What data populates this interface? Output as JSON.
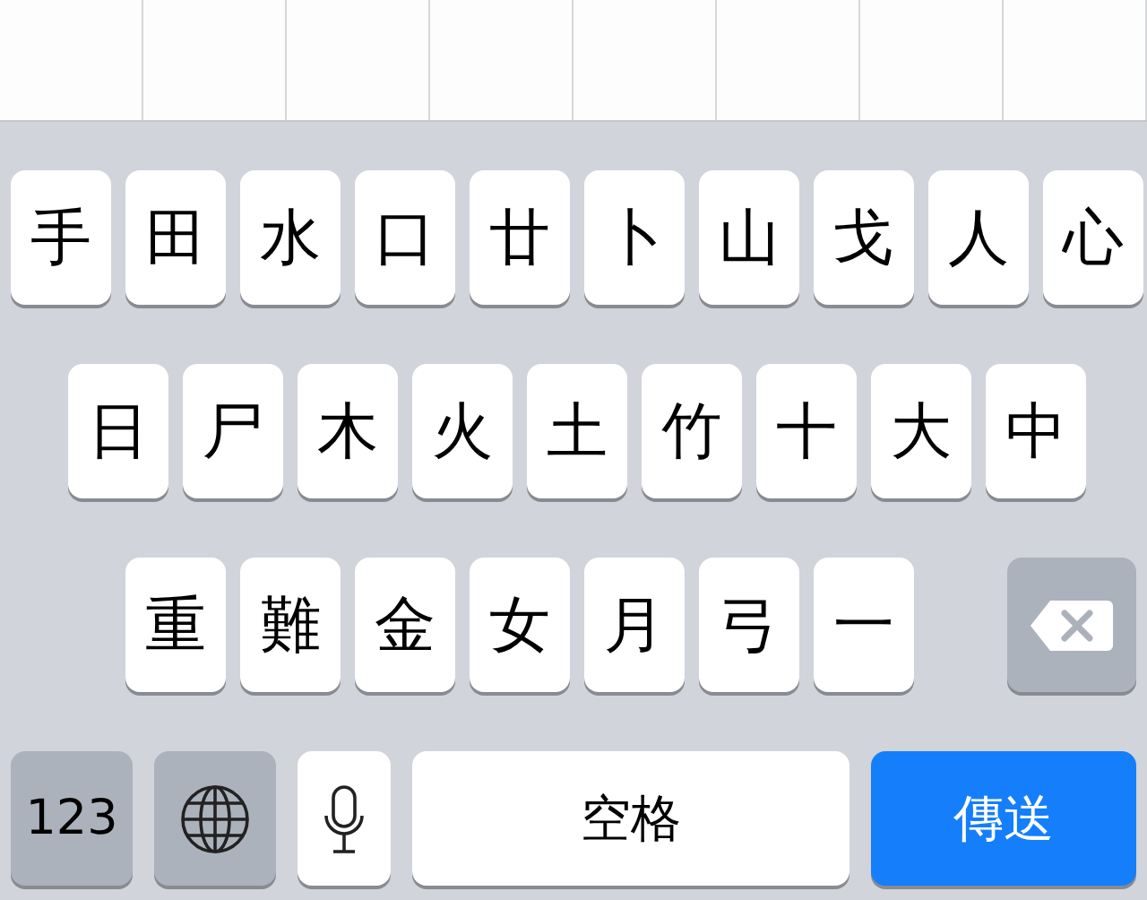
{
  "rows": [
    [
      {
        "kind": "char",
        "label": "手"
      },
      {
        "kind": "char",
        "label": "田"
      },
      {
        "kind": "char",
        "label": "水"
      },
      {
        "kind": "char",
        "label": "口"
      },
      {
        "kind": "char",
        "label": "廿"
      },
      {
        "kind": "char",
        "label": "卜"
      },
      {
        "kind": "char",
        "label": "山"
      },
      {
        "kind": "char",
        "label": "戈"
      },
      {
        "kind": "char",
        "label": "人"
      },
      {
        "kind": "char",
        "label": "心"
      }
    ],
    [
      {
        "kind": "char",
        "label": "日"
      },
      {
        "kind": "char",
        "label": "尸"
      },
      {
        "kind": "char",
        "label": "木"
      },
      {
        "kind": "char",
        "label": "火"
      },
      {
        "kind": "char",
        "label": "土"
      },
      {
        "kind": "char",
        "label": "竹"
      },
      {
        "kind": "char",
        "label": "十"
      },
      {
        "kind": "char",
        "label": "大"
      },
      {
        "kind": "char",
        "label": "中"
      }
    ],
    [
      {
        "kind": "char",
        "label": "重"
      },
      {
        "kind": "char",
        "label": "難"
      },
      {
        "kind": "char",
        "label": "金"
      },
      {
        "kind": "char",
        "label": "女"
      },
      {
        "kind": "char",
        "label": "月"
      },
      {
        "kind": "char",
        "label": "弓"
      },
      {
        "kind": "char",
        "label": "一"
      },
      {
        "kind": "delete"
      }
    ]
  ],
  "bottom_row": [
    {
      "kind": "numbers",
      "label": "123"
    },
    {
      "kind": "globe"
    },
    {
      "kind": "mic"
    },
    {
      "kind": "space",
      "label": "空格"
    },
    {
      "kind": "send",
      "label": "傳送"
    }
  ]
}
